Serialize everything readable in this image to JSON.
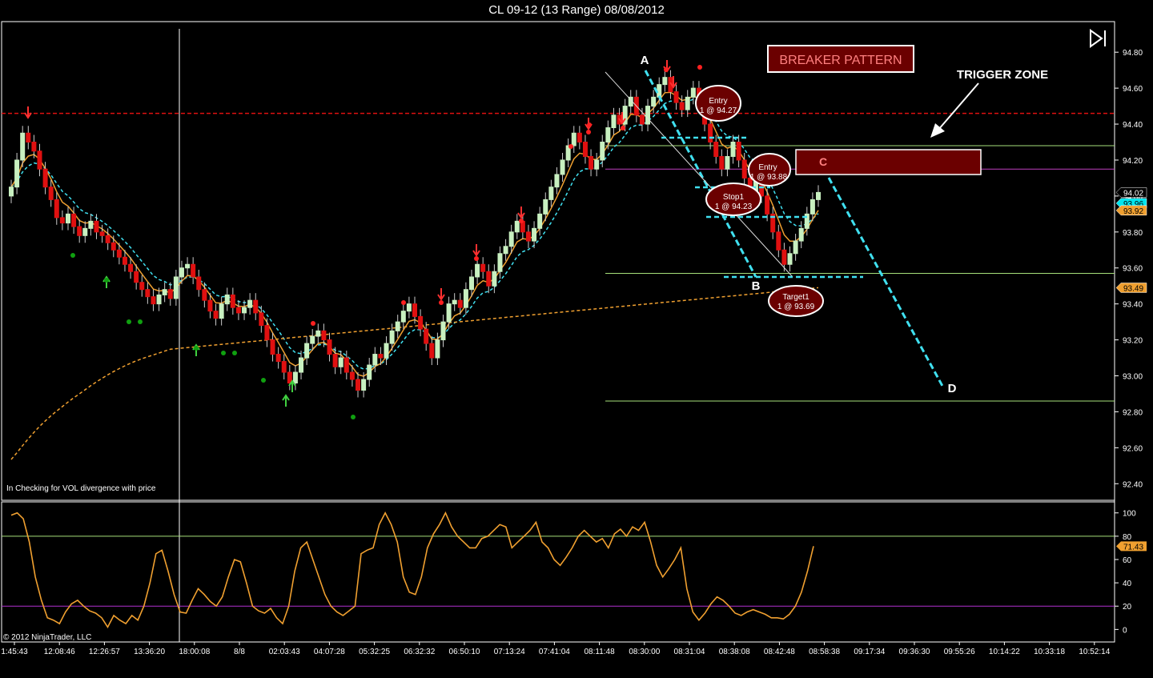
{
  "window": {
    "title": "CL 09-12 (13 Range)  08/08/2012"
  },
  "chart_data": {
    "type": "candlestick",
    "instrument": "CL 09-12",
    "bar_type": "13 Range",
    "date": "08/08/2012",
    "price_axis": {
      "ticks": [
        "94.80",
        "94.60",
        "94.40",
        "94.20",
        "94.00",
        "93.80",
        "93.60",
        "93.40",
        "93.20",
        "93.00",
        "92.80",
        "92.60",
        "92.40"
      ],
      "range": [
        92.33,
        94.93
      ]
    },
    "price_badges": [
      {
        "value": "94.02",
        "bg": "#000000",
        "fg": "#ffffff"
      },
      {
        "value": "93.96",
        "bg": "#00e5ee",
        "fg": "#000000"
      },
      {
        "value": "93.92",
        "bg": "#f0a030",
        "fg": "#000000"
      },
      {
        "value": "93.49",
        "bg": "#f0a030",
        "fg": "#000000"
      }
    ],
    "time_axis": [
      "1:45:43",
      "12:08:46",
      "12:26:57",
      "13:36:20",
      "18:00:08",
      "8/8",
      "02:03:43",
      "04:07:28",
      "05:32:25",
      "06:32:32",
      "06:50:10",
      "07:13:24",
      "07:41:04",
      "08:11:48",
      "08:30:00",
      "08:31:04",
      "08:38:08",
      "08:42:48",
      "08:58:38",
      "09:17:34",
      "09:36:30",
      "09:55:26",
      "10:14:22",
      "10:33:18",
      "10:52:14"
    ],
    "closes": [
      94.05,
      94.2,
      94.35,
      94.3,
      94.25,
      94.15,
      94.05,
      93.98,
      93.88,
      93.85,
      93.9,
      93.83,
      93.78,
      93.82,
      93.86,
      93.8,
      93.78,
      93.74,
      93.7,
      93.66,
      93.62,
      93.58,
      93.52,
      93.48,
      93.44,
      93.4,
      93.45,
      93.48,
      93.43,
      93.55,
      93.6,
      93.62,
      93.55,
      93.48,
      93.42,
      93.36,
      93.32,
      93.4,
      93.45,
      93.38,
      93.35,
      93.38,
      93.42,
      93.35,
      93.28,
      93.2,
      93.12,
      93.08,
      93.02,
      92.96,
      93.02,
      93.1,
      93.18,
      93.22,
      93.25,
      93.2,
      93.12,
      93.05,
      93.1,
      93.02,
      92.98,
      92.92,
      92.98,
      93.06,
      93.12,
      93.1,
      93.18,
      93.25,
      93.3,
      93.36,
      93.4,
      93.33,
      93.26,
      93.18,
      93.1,
      93.2,
      93.3,
      93.4,
      93.42,
      93.38,
      93.48,
      93.55,
      93.62,
      93.58,
      93.5,
      93.58,
      93.68,
      93.72,
      93.8,
      93.86,
      93.8,
      93.75,
      93.82,
      93.9,
      93.98,
      94.05,
      94.12,
      94.2,
      94.28,
      94.35,
      94.3,
      94.22,
      94.15,
      94.2,
      94.3,
      94.38,
      94.45,
      94.4,
      94.5,
      94.55,
      94.45,
      94.4,
      94.5,
      94.55,
      94.62,
      94.66,
      94.58,
      94.52,
      94.48,
      94.55,
      94.6,
      94.5,
      94.4,
      94.3,
      94.22,
      94.15,
      94.22,
      94.3,
      94.2,
      94.1,
      94.02,
      94.1,
      94.0,
      93.9,
      93.8,
      93.7,
      93.62,
      93.68,
      93.75,
      93.82,
      93.9,
      93.98,
      94.02
    ],
    "oscillator": {
      "ticks": [
        "100",
        "80",
        "60",
        "40",
        "20",
        "0"
      ],
      "range": [
        -8,
        106
      ],
      "levels": [
        80,
        20
      ],
      "last_value": "71.43",
      "values": [
        98,
        100,
        95,
        75,
        45,
        25,
        10,
        8,
        5,
        15,
        22,
        25,
        20,
        16,
        14,
        10,
        2,
        12,
        8,
        5,
        12,
        8,
        20,
        40,
        65,
        68,
        50,
        30,
        15,
        14,
        25,
        35,
        30,
        24,
        20,
        28,
        45,
        60,
        58,
        40,
        20,
        16,
        14,
        18,
        10,
        5,
        20,
        50,
        70,
        75,
        60,
        45,
        30,
        20,
        15,
        12,
        16,
        20,
        65,
        68,
        70,
        90,
        100,
        90,
        75,
        45,
        32,
        30,
        45,
        70,
        82,
        90,
        100,
        88,
        80,
        75,
        70,
        70,
        78,
        80,
        85,
        90,
        88,
        70,
        75,
        80,
        85,
        92,
        75,
        70,
        60,
        55,
        62,
        70,
        80,
        85,
        80,
        75,
        78,
        70,
        82,
        86,
        80,
        88,
        85,
        92,
        75,
        55,
        45,
        52,
        60,
        70,
        35,
        15,
        8,
        14,
        22,
        28,
        25,
        20,
        14,
        12,
        15,
        17,
        15,
        13,
        10,
        10,
        9,
        13,
        20,
        32,
        50,
        71.43
      ]
    },
    "annotations": {
      "title_box": "BREAKER PATTERN",
      "trigger_zone": "TRIGGER ZONE",
      "points": [
        "A",
        "B",
        "C",
        "D"
      ],
      "orders": [
        {
          "label": "Entry",
          "detail": "1 @ 94.27"
        },
        {
          "label": "Entry",
          "detail": "1 @ 93.88"
        },
        {
          "label": "Stop1",
          "detail": "1 @ 94.23"
        },
        {
          "label": "Target1",
          "detail": "1 @ 93.69"
        }
      ],
      "horizontal_levels": [
        94.46,
        94.28,
        94.15,
        93.57,
        92.86
      ]
    },
    "indicator_note": "In  Checking for VOL  divergence with price",
    "copyright": "© 2012 NinjaTrader, LLC"
  }
}
